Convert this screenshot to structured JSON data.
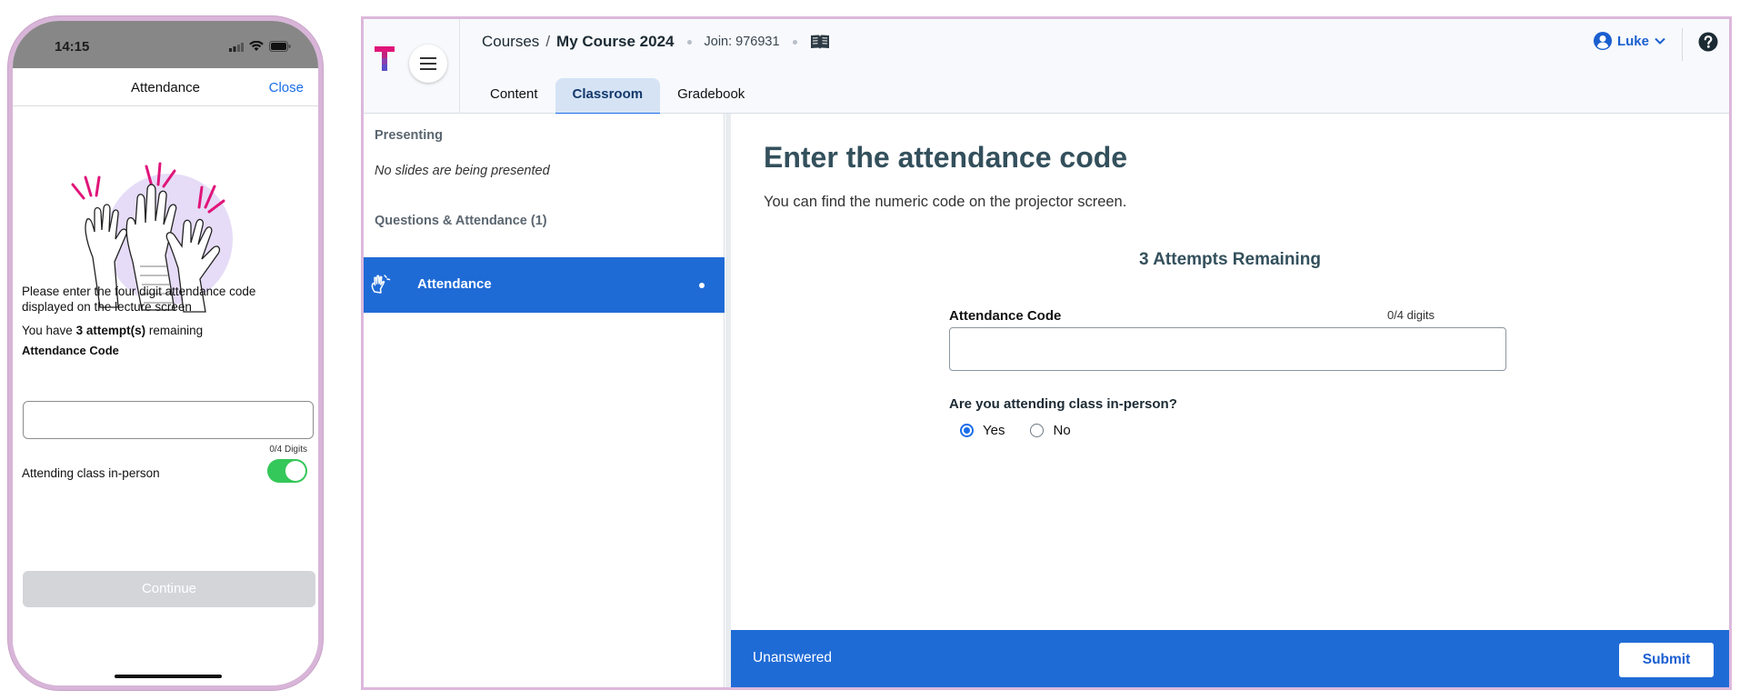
{
  "phone": {
    "time": "14:15",
    "sheet_title": "Attendance",
    "close_label": "Close",
    "instructions": "Please enter the four digit attendance code displayed on the lecture screen",
    "attempts_prefix": "You have ",
    "attempts_bold": "3 attempt(s)",
    "attempts_suffix": " remaining",
    "code_label": "Attendance Code",
    "code_value": "",
    "digits_count": "0/4 Digits",
    "in_person_label": "Attending class in-person",
    "in_person_on": true,
    "continue_label": "Continue"
  },
  "app": {
    "breadcrumb": {
      "courses": "Courses",
      "separator": "/",
      "course": "My Course 2024"
    },
    "join": "Join: 976931",
    "tabs": [
      {
        "label": "Content",
        "active": false
      },
      {
        "label": "Classroom",
        "active": true
      },
      {
        "label": "Gradebook",
        "active": false
      }
    ],
    "user_name": "Luke",
    "sidebar": {
      "presenting_heading": "Presenting",
      "presenting_empty": "No slides are being presented",
      "questions_heading": "Questions & Attendance (1)",
      "items": [
        {
          "label": "Attendance",
          "selected": true
        }
      ]
    },
    "main": {
      "title": "Enter the attendance code",
      "subtitle": "You can find the numeric code on the projector screen.",
      "attempts": "3 Attempts Remaining",
      "code_label": "Attendance Code",
      "code_count": "0/4 digits",
      "code_value": "",
      "question": "Are you attending class in-person?",
      "options": [
        {
          "label": "Yes",
          "selected": true
        },
        {
          "label": "No",
          "selected": false
        }
      ]
    },
    "footer": {
      "status": "Unanswered",
      "submit_label": "Submit"
    }
  },
  "colors": {
    "accent": "#1f6bd6",
    "toggle_green": "#34c759",
    "heading": "#33505c"
  }
}
